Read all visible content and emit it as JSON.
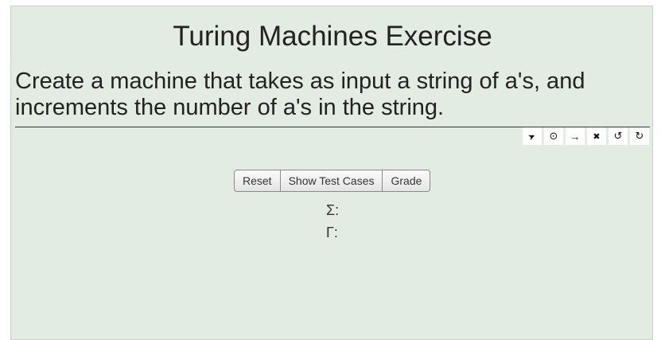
{
  "header": {
    "title": "Turing Machines Exercise",
    "description": "Create a machine that takes as input a string of a's, and increments the number of a's in the string."
  },
  "toolbar": {
    "tools": [
      {
        "name": "select-tool",
        "glyph": "➤"
      },
      {
        "name": "add-node-tool",
        "glyph": "⊙"
      },
      {
        "name": "add-edge-tool",
        "glyph": "→"
      },
      {
        "name": "delete-tool",
        "glyph": "✖"
      },
      {
        "name": "undo-tool",
        "glyph": "↺"
      },
      {
        "name": "redo-tool",
        "glyph": "↻"
      }
    ]
  },
  "controls": {
    "reset_label": "Reset",
    "show_tests_label": "Show Test Cases",
    "grade_label": "Grade"
  },
  "alphabets": {
    "input_label": "Σ:",
    "tape_label": "Γ:"
  },
  "colors": {
    "panel_background": "#e2ece2"
  }
}
